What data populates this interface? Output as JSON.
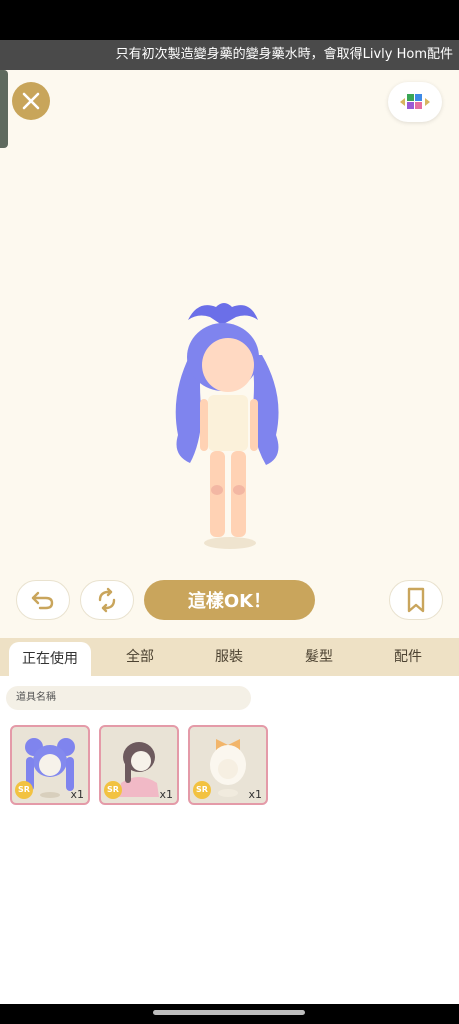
{
  "banner": {
    "text": "只有初次製造變身藥的變身藥水時，會取得Livly Hom配件"
  },
  "toolbar": {
    "close_icon": "close-icon",
    "palette_icon": "palette-icon",
    "undo_icon": "undo-icon",
    "refresh_icon": "refresh-icon",
    "ok_label": "這樣OK！",
    "bookmark_icon": "bookmark-icon"
  },
  "tabs": [
    {
      "label": "正在使用",
      "active": true
    },
    {
      "label": "全部"
    },
    {
      "label": "服裝"
    },
    {
      "label": "髮型"
    },
    {
      "label": "配件"
    }
  ],
  "search": {
    "placeholder": "道具名稱"
  },
  "items": [
    {
      "rarity": "SR",
      "count": "x1",
      "icon": "blue-twin-tail-hair-icon"
    },
    {
      "rarity": "SR",
      "count": "x1",
      "icon": "dark-hair-pink-outfit-icon"
    },
    {
      "rarity": "SR",
      "count": "x1",
      "icon": "white-hood-bow-icon"
    }
  ],
  "colors": {
    "accent_gold": "#c9a55c",
    "stage_bg": "#fdf9ef",
    "tab_bar_bg": "#eee1c5",
    "item_border": "#e49aa8",
    "rarity_badge": "#f2c241"
  }
}
